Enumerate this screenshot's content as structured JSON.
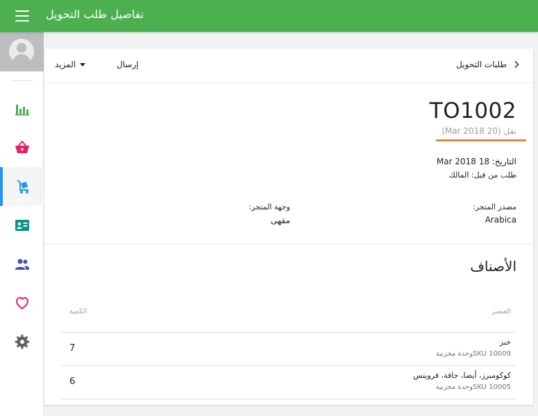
{
  "topbar": {
    "title": "تفاصيل طلب التحويل"
  },
  "sidebar": {
    "items": [
      {
        "name": "reports",
        "icon": "bar-chart-icon",
        "color": "#4caf50"
      },
      {
        "name": "sales",
        "icon": "basket-icon",
        "color": "#e91e63"
      },
      {
        "name": "transfers",
        "icon": "cart-icon",
        "color": "#2196f3",
        "active": true
      },
      {
        "name": "employees",
        "icon": "badge-icon",
        "color": "#009688"
      },
      {
        "name": "customers",
        "icon": "people-icon",
        "color": "#3f51b5"
      },
      {
        "name": "loyalty",
        "icon": "heart-icon",
        "color": "#e91e63"
      },
      {
        "name": "settings",
        "icon": "gear-icon",
        "color": "#616161"
      }
    ]
  },
  "toolbar": {
    "back_label": "طلبات التحويل",
    "send_label": "إرسال",
    "more_label": "المزيد"
  },
  "document": {
    "id": "TO1002",
    "subtitle": "نقل (20 Mar 2018)",
    "date_line": "التاريخ: 18 Mar 2018",
    "requested_by": "طلب من قبل: المالك"
  },
  "source": {
    "label": "مصدر المتجر:",
    "value": "Arabica"
  },
  "destination": {
    "label": "وجهة المتجر:",
    "value": "مقهى"
  },
  "items_section": {
    "title": "الأصناف",
    "col_item": "العنصر",
    "col_qty": "الكمية",
    "rows": [
      {
        "name": "خبز",
        "sku": "SKU 10009وحدة مخزنية",
        "qty": "7"
      },
      {
        "name": "كوكومبرز، أيضا، جافة، فرويتس",
        "sku": "SKU 10005وحدة مخزنية",
        "qty": "6"
      }
    ]
  },
  "colors": {
    "primary": "#4caf50",
    "accent": "#2196f3",
    "highlight": "#ef7f3b"
  }
}
